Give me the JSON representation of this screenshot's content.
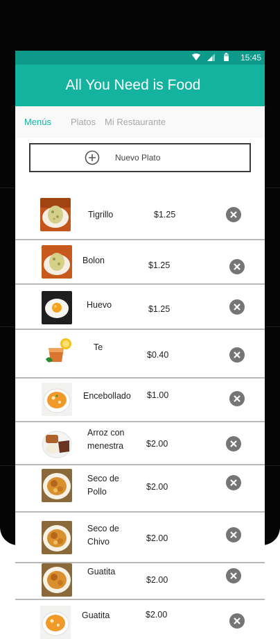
{
  "status_bar": {
    "time": "15:45"
  },
  "app": {
    "title": "All You Need is Food"
  },
  "tabs": [
    {
      "label": "Menús",
      "active": true
    },
    {
      "label": "Platos",
      "active": false
    },
    {
      "label": "Mi Restaurante",
      "active": false
    }
  ],
  "new_dish": {
    "label": "Nuevo Plato"
  },
  "dishes": [
    {
      "name": "Tigrillo",
      "price": "$1.25",
      "image": "tigrillo"
    },
    {
      "name": "Bolon",
      "price": "$1.25",
      "image": "bolon"
    },
    {
      "name": "Huevo",
      "price": "$1.25",
      "image": "egg"
    },
    {
      "name": "Te",
      "price": "$0.40",
      "image": "tea"
    },
    {
      "name": "Encebollado",
      "price": "$1.00",
      "image": "soup"
    },
    {
      "name": "Arroz con menestra",
      "price": "$2.00",
      "image": "rice-beans"
    },
    {
      "name": "Seco de Pollo",
      "price": "$2.00",
      "image": "stew"
    },
    {
      "name": "Seco de Chivo",
      "price": "$2.00",
      "image": "stew"
    },
    {
      "name": "Guatita",
      "price": "$2.00",
      "image": "stew"
    },
    {
      "name": "Guatita",
      "price": "$2.00",
      "image": "soup"
    }
  ],
  "colors": {
    "primary": "#13b3a0",
    "status_bar": "#0e9a8a",
    "delete_icon": "#757575"
  }
}
